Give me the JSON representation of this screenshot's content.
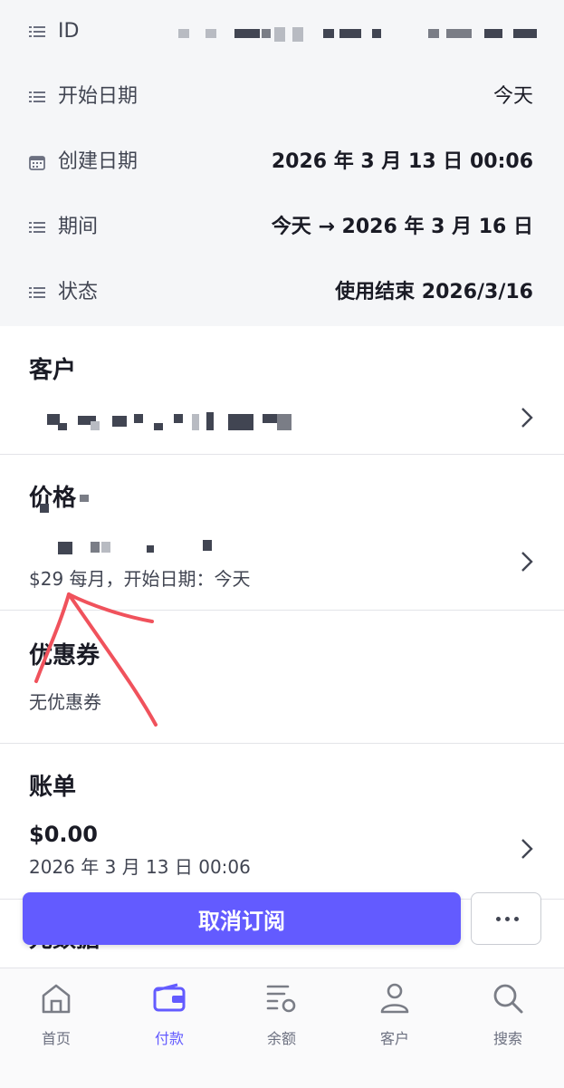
{
  "details": {
    "rows": [
      {
        "label": "ID",
        "value": ""
      },
      {
        "label": "开始日期",
        "value": "今天"
      },
      {
        "label": "创建日期",
        "value": "2026 年 3 月 13 日 00:06"
      },
      {
        "label": "期间",
        "value": "今天 → 2026 年 3 月 16 日"
      },
      {
        "label": "状态",
        "value": "使用结束 2026/3/16"
      }
    ]
  },
  "customer": {
    "title": "客户"
  },
  "price": {
    "title": "价格",
    "description": "$29 每月，开始日期：今天"
  },
  "coupon": {
    "title": "优惠券",
    "value": "无优惠券"
  },
  "invoice": {
    "title": "账单",
    "amount": "$0.00",
    "date": "2026 年 3 月 13 日 00:06"
  },
  "metadata_peek": {
    "title": "元数据"
  },
  "actions": {
    "cancel_label": "取消订阅",
    "more_label": "•••"
  },
  "tabs": [
    {
      "label": "首页",
      "icon": "home-icon"
    },
    {
      "label": "付款",
      "icon": "wallet-icon",
      "active": true
    },
    {
      "label": "余额",
      "icon": "balance-icon"
    },
    {
      "label": "客户",
      "icon": "user-icon"
    },
    {
      "label": "搜索",
      "icon": "search-icon"
    }
  ],
  "colors": {
    "accent": "#635bff",
    "annotation": "#f0525c"
  }
}
